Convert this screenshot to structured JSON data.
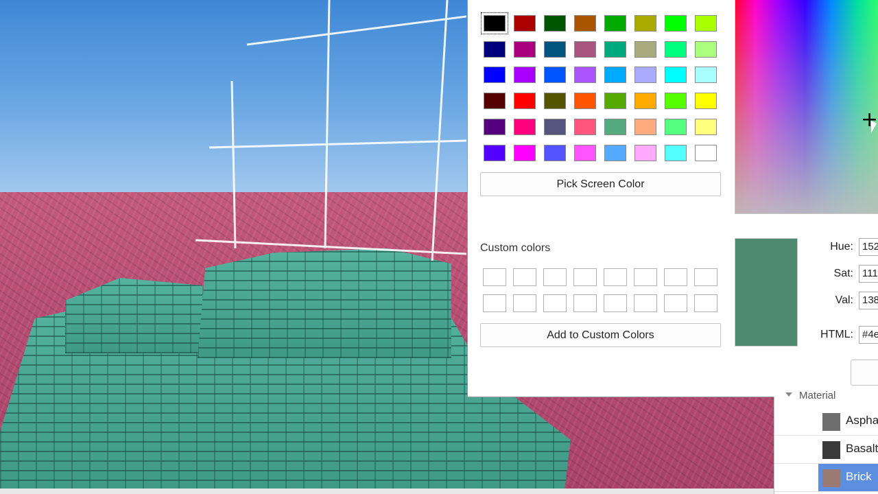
{
  "dialog": {
    "basic_colors": [
      "#000000",
      "#aa0000",
      "#005500",
      "#aa5500",
      "#00aa00",
      "#aaaa00",
      "#00ff00",
      "#aaff00",
      "#00007f",
      "#aa007f",
      "#00557f",
      "#aa557f",
      "#00aa7f",
      "#aaaa7f",
      "#00ff7f",
      "#aaff7f",
      "#0000ff",
      "#aa00ff",
      "#0055ff",
      "#aa55ff",
      "#00aaff",
      "#aaaaff",
      "#00ffff",
      "#aaffff",
      "#550000",
      "#ff0000",
      "#555500",
      "#ff5500",
      "#55aa00",
      "#ffaa00",
      "#55ff00",
      "#ffff00",
      "#55007f",
      "#ff007f",
      "#55557f",
      "#ff557f",
      "#55aa7f",
      "#ffaa7f",
      "#55ff7f",
      "#ffff7f",
      "#5500ff",
      "#ff00ff",
      "#5555ff",
      "#ff55ff",
      "#55aaff",
      "#ffaaff",
      "#55ffff",
      "#ffffff"
    ],
    "pick_screen_label": "Pick Screen Color",
    "custom_colors_label": "Custom colors",
    "add_custom_label": "Add to Custom Colors",
    "preview_color": "#4e8a6f",
    "hue_label": "Hue:",
    "hue_value": "152",
    "sat_label": "Sat:",
    "sat_value": "111",
    "val_label": "Val:",
    "val_value": "138",
    "html_label": "HTML:",
    "html_value": "#4e"
  },
  "properties": {
    "material_header": "Material",
    "materials": [
      {
        "label": "Aspha",
        "thumb": "#6e6e6e",
        "selected": false
      },
      {
        "label": "Basalt",
        "thumb": "#3a3a3a",
        "selected": false
      },
      {
        "label": "Brick",
        "thumb": "#9a7a72",
        "selected": true
      }
    ]
  }
}
